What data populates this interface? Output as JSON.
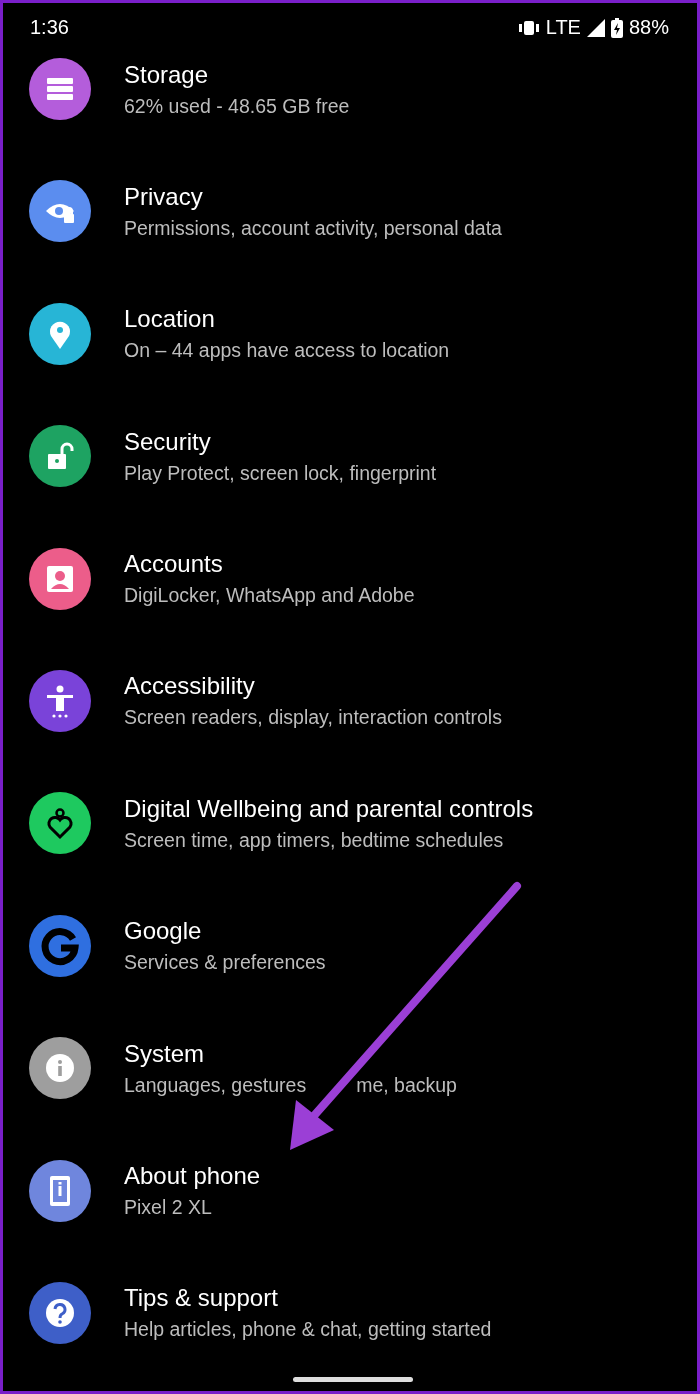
{
  "status_bar": {
    "time": "1:36",
    "network": "LTE",
    "battery": "88%"
  },
  "settings": [
    {
      "title": "Storage",
      "subtitle": "62% used - 48.65 GB free",
      "color": "#b45ddb"
    },
    {
      "title": "Privacy",
      "subtitle": "Permissions, account activity, personal data",
      "color": "#5b8def"
    },
    {
      "title": "Location",
      "subtitle": "On – 44 apps have access to location",
      "color": "#27b5d6"
    },
    {
      "title": "Security",
      "subtitle": "Play Protect, screen lock, fingerprint",
      "color": "#1ea362"
    },
    {
      "title": "Accounts",
      "subtitle": "DigiLocker, WhatsApp and Adobe",
      "color": "#ec5d8a"
    },
    {
      "title": "Accessibility",
      "subtitle": "Screen readers, display, interaction controls",
      "color": "#7a43d9"
    },
    {
      "title": "Digital Wellbeing and parental controls",
      "subtitle": "Screen time, app timers, bedtime schedules",
      "color": "#1ec95f"
    },
    {
      "title": "Google",
      "subtitle": "Services & preferences",
      "color": "#2f6fe0"
    },
    {
      "title": "System",
      "subtitle": [
        "Languages, gestures",
        "me, backup"
      ],
      "color": "#9e9e9e"
    },
    {
      "title": "About phone",
      "subtitle": "Pixel 2 XL",
      "color": "#6f86dd"
    },
    {
      "title": "Tips & support",
      "subtitle": "Help articles, phone & chat, getting started",
      "color": "#3e5fc8"
    }
  ]
}
